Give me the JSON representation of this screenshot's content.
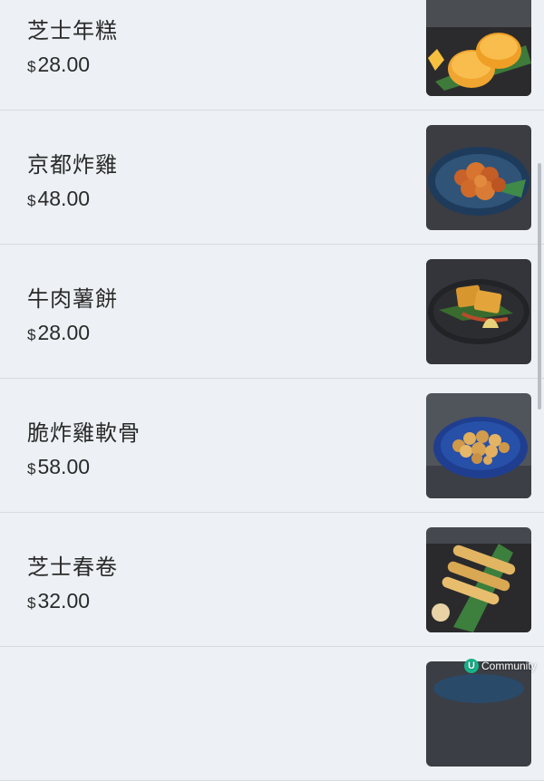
{
  "menu": {
    "currency_symbol": "$",
    "items": [
      {
        "name": "芝士年糕",
        "price": "28.00",
        "image": "cheese-rice-cake-image"
      },
      {
        "name": "京都炸雞",
        "price": "48.00",
        "image": "kyoto-fried-chicken-image"
      },
      {
        "name": "牛肉薯餅",
        "price": "28.00",
        "image": "beef-hash-brown-image"
      },
      {
        "name": "脆炸雞軟骨",
        "price": "58.00",
        "image": "fried-chicken-cartilage-image"
      },
      {
        "name": "芝士春卷",
        "price": "32.00",
        "image": "cheese-spring-roll-image"
      },
      {
        "name": "",
        "price": "",
        "image": "partially-visible-dish-image"
      }
    ]
  },
  "watermark": {
    "logo": "U",
    "text": "Community"
  },
  "colors": {
    "background": "#edf1f5",
    "divider": "#d6dbe0",
    "text": "#2a2a2a",
    "watermark_logo": "#19b28a"
  }
}
